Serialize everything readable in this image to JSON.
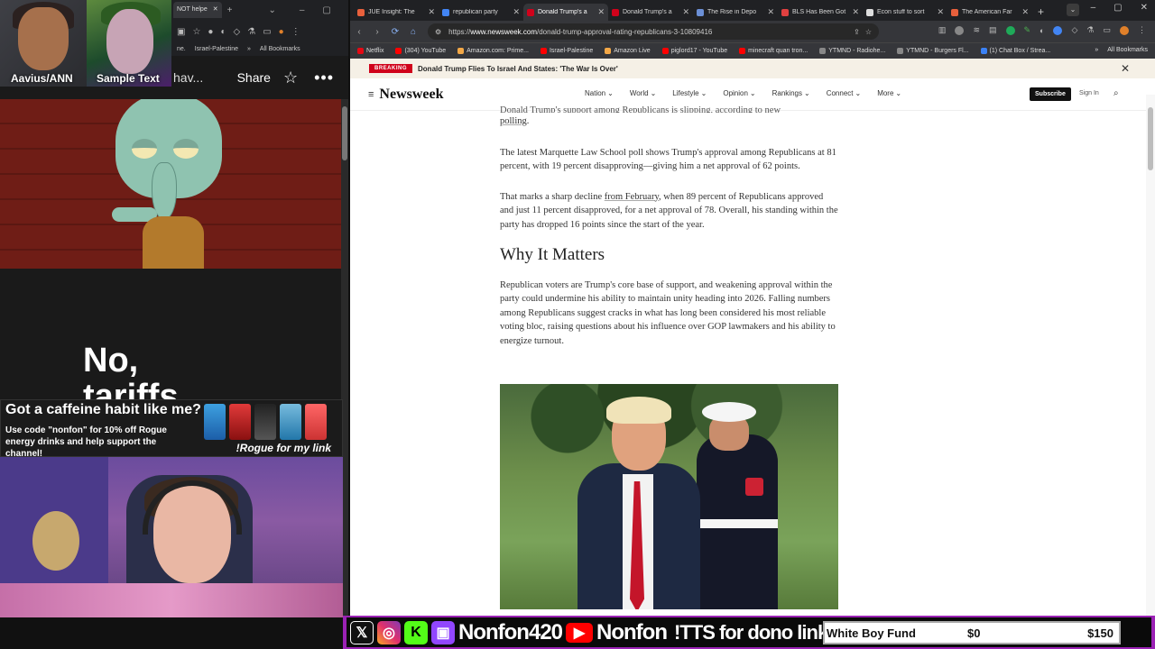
{
  "left_panel": {
    "browser_tabs": [
      {
        "label": "NOT helpe"
      }
    ],
    "bookmarks": [
      "ne.",
      "Israel-Palestine",
      "All Bookmarks"
    ],
    "users": [
      {
        "name": "Aavius/ANN"
      },
      {
        "name": "Sample Text"
      }
    ],
    "header": {
      "partial_text": "hav...",
      "share_label": "Share"
    },
    "meme_text_line1": "No,",
    "meme_text_line2": "tariffs",
    "ad": {
      "headline": "Got a caffeine habit like me?",
      "body": "Use code \"nonfon\" for 10% off Rogue energy drinks and help support the channel!",
      "cta": "!Rogue for my link"
    }
  },
  "browser": {
    "tabs": [
      {
        "label": "JUE Insight: The ",
        "icon": "doc-icon",
        "color": "#e8603c"
      },
      {
        "label": "republican party ",
        "icon": "google-icon",
        "color": "#4285f4"
      },
      {
        "label": "Donald Trump's a",
        "icon": "newsweek-icon",
        "color": "#d0021b",
        "active": true
      },
      {
        "label": "Donald Trump's a",
        "icon": "newsweek-icon",
        "color": "#d0021b"
      },
      {
        "label": "The Rise in Depo",
        "icon": "doc-icon",
        "color": "#6b8fd6"
      },
      {
        "label": "BLS Has Been Got",
        "icon": "doc-icon",
        "color": "#e04040"
      },
      {
        "label": "Econ stuff to sort",
        "icon": "notion-icon",
        "color": "#dddddd"
      },
      {
        "label": "The American Far",
        "icon": "doc-icon",
        "color": "#e8603c"
      }
    ],
    "url_prefix": "https://",
    "url_host": "www.newsweek.com",
    "url_path": "/donald-trump-approval-rating-republicans-3-10809416",
    "bookmarks": [
      {
        "label": "Netflix",
        "color": "#e50914"
      },
      {
        "label": "(304) YouTube",
        "color": "#ff0000"
      },
      {
        "label": "Amazon.com: Prime...",
        "color": "#f3a847"
      },
      {
        "label": "Israel-Palestine",
        "color": "#ff0000"
      },
      {
        "label": "Amazon Live",
        "color": "#f3a847"
      },
      {
        "label": "piglord17 - YouTube",
        "color": "#ff0000"
      },
      {
        "label": "minecraft quan tron...",
        "color": "#ff0000"
      },
      {
        "label": "YTMND - Radiohe...",
        "color": "#888888"
      },
      {
        "label": "YTMND - Burgers Fl...",
        "color": "#888888"
      },
      {
        "label": "(1) Chat Box / Strea...",
        "color": "#3b82f6"
      }
    ],
    "all_bookmarks": "All Bookmarks"
  },
  "newsweek": {
    "breaking_label": "BREAKING",
    "breaking_text": "Donald Trump Flies To Israel And States: 'The War Is Over'",
    "logo": "Newsweek",
    "menu": [
      "Nation",
      "World",
      "Lifestyle",
      "Opinion",
      "Rankings",
      "Connect",
      "More"
    ],
    "subscribe": "Subscribe",
    "sign_in": "Sign In",
    "article": {
      "cut_line": "Donald Trump's support among Republicans is slipping, according to new",
      "cut_link": "polling",
      "p1": "The latest Marquette Law School poll shows Trump's approval among Republicans at 81 percent, with 19 percent disapproving—giving him a net approval of 62 points.",
      "p2_a": "That marks a sharp decline ",
      "p2_link": "from February",
      "p2_b": ", when 89 percent of Republicans approved and just 11 percent disapproved, for a net approval of 78. Overall, his standing within the party has dropped 16 points since the start of the year.",
      "h2": "Why It Matters",
      "p3": "Republican voters are Trump's core base of support, and weakening approval within the party could undermine his ability to maintain unity heading into 2026. Falling numbers among Republicans suggest cracks in what has long been considered his most reliable voting bloc, raising questions about his influence over GOP lawmakers and his ability to energize turnout."
    }
  },
  "stream_bar": {
    "handle1": "Nonfon420",
    "handle2": "Nonfon",
    "tts": "!TTS for dono link",
    "fund_name": "White Boy Fund",
    "fund_current": "$0",
    "fund_goal": "$150",
    "fund_progress": 0
  }
}
